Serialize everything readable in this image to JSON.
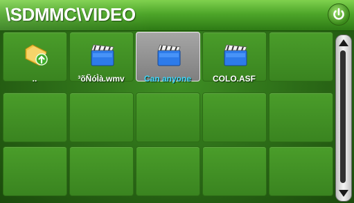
{
  "window": {
    "title": "\\SDMMC\\VIDEO"
  },
  "toolbar": {
    "power_icon": "power-icon"
  },
  "files": [
    {
      "label": "..",
      "icon": "folder-up-icon",
      "selected": false
    },
    {
      "label": "³õÑóÌà.wmv",
      "icon": "clapperboard-icon",
      "selected": false
    },
    {
      "label": "Can anyone",
      "icon": "clapperboard-icon",
      "selected": true
    },
    {
      "label": "COLO.ASF",
      "icon": "clapperboard-icon",
      "selected": false
    }
  ],
  "colors": {
    "accent": "#4ea62a",
    "selected_text": "#3fd6ff",
    "selected_tile": "#8f8f8f"
  }
}
